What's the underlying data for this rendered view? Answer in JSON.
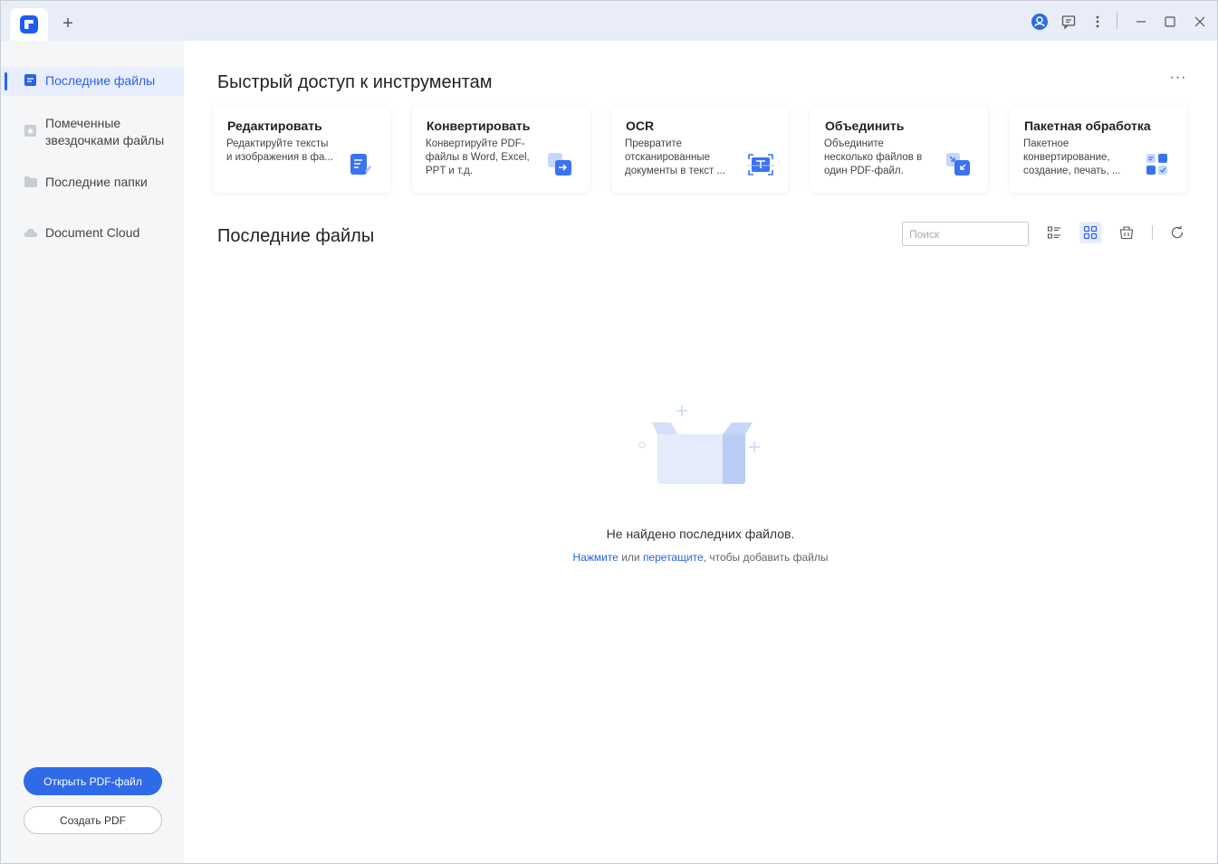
{
  "titlebar": {
    "new_tab_label": "+",
    "icons": [
      "app-logo-icon",
      "user-icon",
      "feedback-icon",
      "more-vertical-icon",
      "minimize-icon",
      "maximize-icon",
      "close-icon"
    ]
  },
  "sidebar": {
    "items": [
      {
        "label": "Последние файлы",
        "icon": "recent-files-icon",
        "active": true
      },
      {
        "label": "Помеченные звездочками файлы",
        "icon": "starred-icon",
        "active": false
      },
      {
        "label": "Последние папки",
        "icon": "folder-icon",
        "active": false
      },
      {
        "label": "Document Cloud",
        "icon": "cloud-icon",
        "active": false
      }
    ],
    "open_pdf_label": "Открыть PDF-файл",
    "create_pdf_label": "Создать PDF"
  },
  "quick_access": {
    "title": "Быстрый доступ к инструментам",
    "more_label": "···",
    "tools": [
      {
        "title": "Редактировать",
        "desc": "Редактируйте тексты и изображения в фа...",
        "icon": "edit-doc-icon"
      },
      {
        "title": "Конвертировать",
        "desc": "Конвертируйте PDF-файлы в Word, Excel, PPT и т.д.",
        "icon": "convert-icon"
      },
      {
        "title": "OCR",
        "desc": "Превратите отсканированные документы в текст ...",
        "icon": "ocr-icon"
      },
      {
        "title": "Объединить",
        "desc": "Объедините несколько файлов в один PDF-файл.",
        "icon": "combine-icon"
      },
      {
        "title": "Пакетная обработка",
        "desc": "Пакетное конвертирование, создание, печать, ...",
        "icon": "batch-icon"
      }
    ]
  },
  "recent": {
    "title": "Последние файлы",
    "search_placeholder": "Поиск",
    "empty_text": "Не найдено последних файлов.",
    "hint_click": "Нажмите",
    "hint_or": " или ",
    "hint_drag": "перетащите",
    "hint_rest": ", чтобы добавить файлы"
  },
  "colors": {
    "accent": "#2f6ae8",
    "titlebar_bg": "#e8edf7",
    "sidebar_bg": "#f5f6f8"
  }
}
